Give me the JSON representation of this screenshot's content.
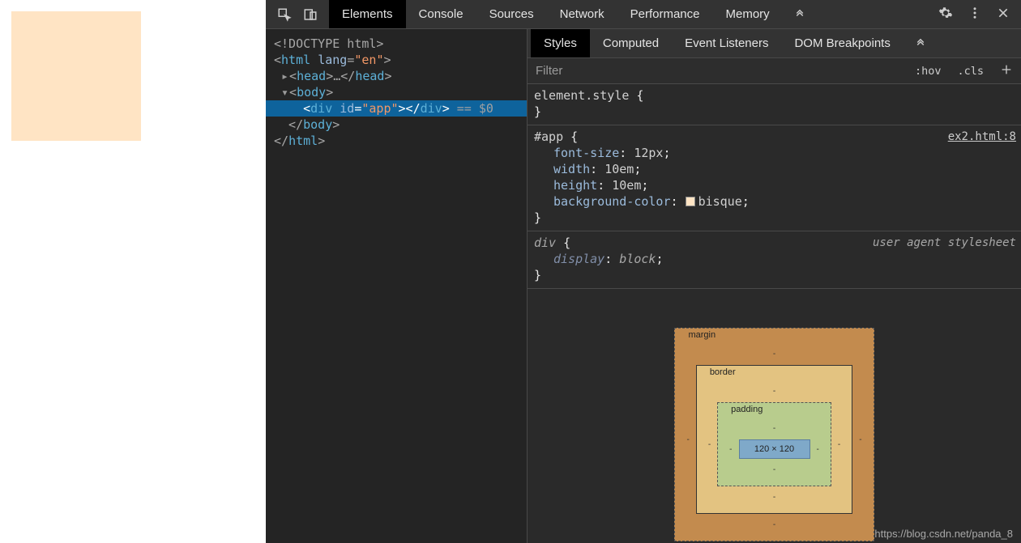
{
  "toolbar": {
    "tabs": [
      "Elements",
      "Console",
      "Sources",
      "Network",
      "Performance",
      "Memory"
    ],
    "activeTab": 0
  },
  "dom": {
    "doctype": "<!DOCTYPE html>",
    "htmlOpen": "html",
    "htmlLang": "en",
    "head": "head",
    "headEllipsis": "…",
    "body": "body",
    "div": "div",
    "divAttrName": "id",
    "divAttrVal": "app",
    "eqSel": "== $0",
    "htmlClose": "html"
  },
  "stylesTabs": [
    "Styles",
    "Computed",
    "Event Listeners",
    "DOM Breakpoints"
  ],
  "stylesActive": 0,
  "filter": {
    "placeholder": "Filter",
    "hov": ":hov",
    "cls": ".cls"
  },
  "rules": {
    "elementStyle": "element.style",
    "app": {
      "selector": "#app",
      "source": "ex2.html:8",
      "props": [
        {
          "n": "font-size",
          "v": "12px"
        },
        {
          "n": "width",
          "v": "10em"
        },
        {
          "n": "height",
          "v": "10em"
        },
        {
          "n": "background-color",
          "v": "bisque",
          "swatch": true
        }
      ]
    },
    "ua": {
      "selector": "div",
      "source": "user agent stylesheet",
      "props": [
        {
          "n": "display",
          "v": "block"
        }
      ]
    }
  },
  "boxModel": {
    "margin": "margin",
    "border": "border",
    "padding": "padding",
    "content": "120 × 120",
    "dash": "-"
  },
  "watermark": "https://blog.csdn.net/panda_8"
}
